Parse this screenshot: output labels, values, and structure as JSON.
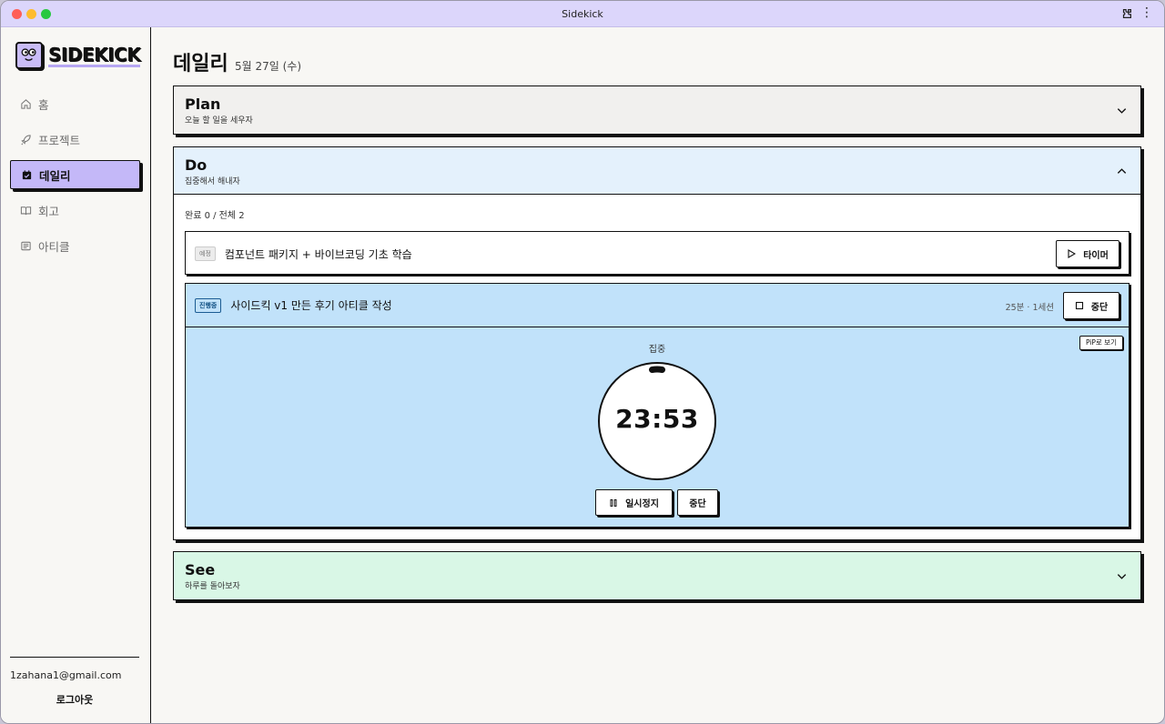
{
  "window": {
    "title": "Sidekick"
  },
  "sidebar": {
    "logo_text": "SIDEKICK",
    "items": [
      {
        "label": "홈",
        "icon": "home-icon",
        "active": false
      },
      {
        "label": "프로젝트",
        "icon": "rocket-icon",
        "active": false
      },
      {
        "label": "데일리",
        "icon": "calendar-check-icon",
        "active": true
      },
      {
        "label": "회고",
        "icon": "book-icon",
        "active": false
      },
      {
        "label": "아티클",
        "icon": "article-icon",
        "active": false
      }
    ],
    "email": "1zahana1@gmail.com",
    "logout_label": "로그아웃"
  },
  "page": {
    "title": "데일리",
    "date": "5월 27일 (수)"
  },
  "plan": {
    "title": "Plan",
    "subtitle": "오늘 할 일을 세우자"
  },
  "do": {
    "title": "Do",
    "subtitle": "집중해서 해내자",
    "progress": "완료 0 / 전체 2",
    "tasks": [
      {
        "badge": "예정",
        "title": "컴포넌트 패키지 + 바이브코딩 기초 학습",
        "button": "타이머"
      },
      {
        "badge": "진행중",
        "title": "사이드킥 v1 만든 후기 아티클 작성",
        "meta": "25분 · 1세션",
        "button": "중단"
      }
    ],
    "timer": {
      "mode_label": "집중",
      "pip_label": "PiP로 보기",
      "time": "23:53",
      "pause_label": "일시정지",
      "stop_label": "중단"
    }
  },
  "see": {
    "title": "See",
    "subtitle": "하루를 돌아보자"
  },
  "colors": {
    "accent_purple": "#c4b8f8",
    "titlebar": "#dcd6fb",
    "do_blue": "#c1e2fa",
    "see_green": "#d9f7e6"
  }
}
